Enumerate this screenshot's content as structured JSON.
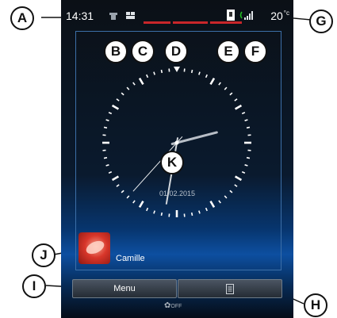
{
  "status": {
    "time": "14:31",
    "temperature": "20",
    "temperature_unit": "°c"
  },
  "clock": {
    "date": "01.02.2015",
    "hour": 14,
    "minute": 31,
    "second": 37
  },
  "contact": {
    "name": "Camille"
  },
  "buttons": {
    "menu_label": "Menu"
  },
  "climate": {
    "fan_label": "OFF"
  },
  "callouts": [
    "A",
    "B",
    "C",
    "D",
    "E",
    "F",
    "G",
    "H",
    "I",
    "J",
    "K"
  ],
  "colors": {
    "lane_bar": "#c8262a",
    "signal": "#22c022",
    "frame": "#3c6fa8"
  }
}
